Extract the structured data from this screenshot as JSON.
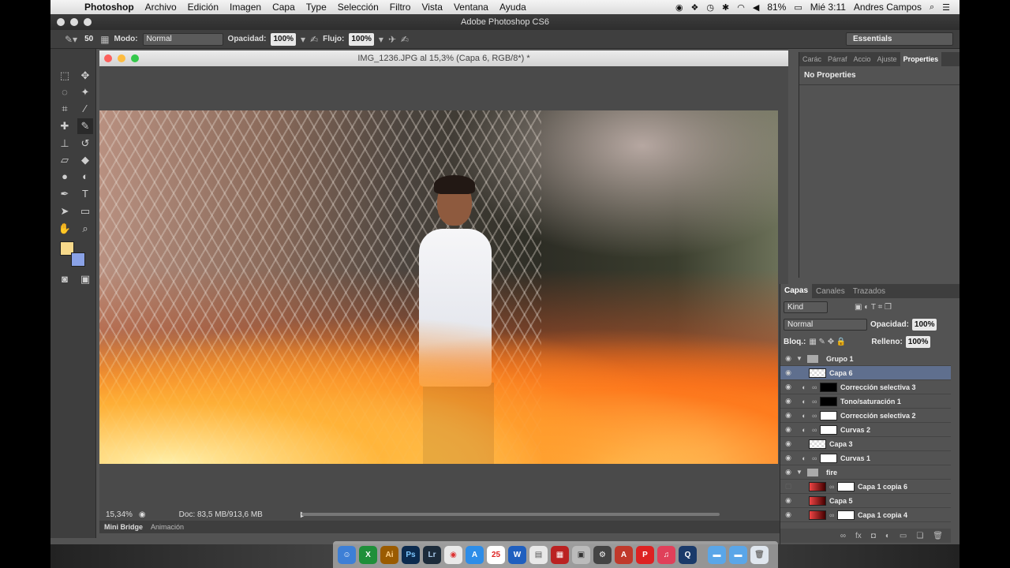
{
  "menubar": {
    "app": "Photoshop",
    "items": [
      "Archivo",
      "Edición",
      "Imagen",
      "Capa",
      "Type",
      "Selección",
      "Filtro",
      "Vista",
      "Ventana",
      "Ayuda"
    ],
    "battery": "81%",
    "clock": "Mié 3:11",
    "user": "Andres Campos"
  },
  "app_title": "Adobe Photoshop CS6",
  "options": {
    "brush_size": "50",
    "mode_label": "Modo:",
    "mode_value": "Normal",
    "opacity_label": "Opacidad:",
    "opacity_value": "100%",
    "flow_label": "Flujo:",
    "flow_value": "100%",
    "workspace": "Essentials"
  },
  "document": {
    "title": "IMG_1236.JPG al 15,3% (Capa 6, RGB/8*) *",
    "zoom": "15,34%",
    "doc_size": "Doc: 83,5 MB/913,6 MB"
  },
  "bottom_tabs": [
    "Mini Bridge",
    "Animación"
  ],
  "properties": {
    "tabs": [
      "Carác",
      "Párraf",
      "Accio",
      "Ajuste",
      "Properties"
    ],
    "empty_text": "No Properties"
  },
  "layers_panel": {
    "tabs": [
      "Capas",
      "Canales",
      "Trazados"
    ],
    "filter": "Kind",
    "blend": "Normal",
    "opacity_label": "Opacidad:",
    "opacity_value": "100%",
    "lock_label": "Bloq.:",
    "fill_label": "Relleno:",
    "fill_value": "100%",
    "layers": [
      {
        "name": "Grupo 1",
        "type": "folder"
      },
      {
        "name": "Capa 6",
        "type": "checker",
        "selected": true
      },
      {
        "name": "Corrección selectiva 3",
        "type": "black"
      },
      {
        "name": "Tono/saturación 1",
        "type": "black"
      },
      {
        "name": "Corrección selectiva 2",
        "type": "white"
      },
      {
        "name": "Curvas 2",
        "type": "white"
      },
      {
        "name": "Capa 3",
        "type": "checker"
      },
      {
        "name": "Curvas 1",
        "type": "white"
      },
      {
        "name": "fire",
        "type": "folder"
      },
      {
        "name": "Capa 1 copia 6",
        "type": "fire"
      },
      {
        "name": "Capa 5",
        "type": "fire"
      },
      {
        "name": "Capa 1 copia 4",
        "type": "fire"
      }
    ]
  },
  "colors": {
    "foreground": "#f7d98b",
    "background": "#8aa2e6",
    "selection": "#5f6f8e"
  }
}
